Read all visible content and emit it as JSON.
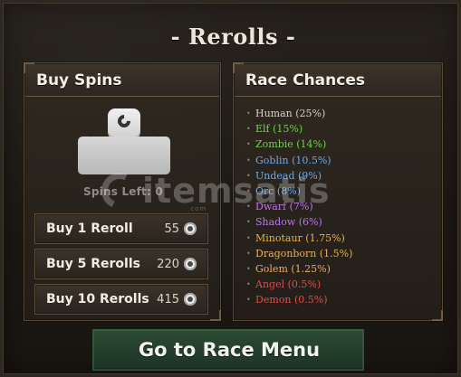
{
  "title": "- Rerolls -",
  "buy_spins": {
    "title": "Buy Spins",
    "spins_left": "Spins Left: 0",
    "options": [
      {
        "label": "Buy 1 Reroll",
        "cost": "55"
      },
      {
        "label": "Buy 5 Rerolls",
        "cost": "220"
      },
      {
        "label": "Buy 10 Rerolls",
        "cost": "415"
      }
    ],
    "currency_icon": "coin-icon",
    "avatar_icon": "character-avatar-icon"
  },
  "race_chances": {
    "title": "Race Chances",
    "items": [
      {
        "label": "Human (25%)",
        "color": "#d7d1c7"
      },
      {
        "label": "Elf (15%)",
        "color": "#73cf52"
      },
      {
        "label": "Zombie (14%)",
        "color": "#73cf52"
      },
      {
        "label": "Goblin (10.5%)",
        "color": "#6aa9ee"
      },
      {
        "label": "Undead (9%)",
        "color": "#6aa9ee"
      },
      {
        "label": "Orc (8%)",
        "color": "#6aa9ee"
      },
      {
        "label": "Dwarf (7%)",
        "color": "#bf73f0"
      },
      {
        "label": "Shadow (6%)",
        "color": "#bf73f0"
      },
      {
        "label": "Minotaur (1.75%)",
        "color": "#efb04a"
      },
      {
        "label": "Dragonborn (1.5%)",
        "color": "#efb04a"
      },
      {
        "label": "Golem (1.25%)",
        "color": "#efb04a"
      },
      {
        "label": "Angel (0.5%)",
        "color": "#e14b4b"
      },
      {
        "label": "Demon (0.5%)",
        "color": "#e14b4b"
      }
    ]
  },
  "go_button": {
    "label": "Go to Race Menu"
  },
  "watermark": {
    "text": "itemsatis",
    "subtext": ".com"
  }
}
